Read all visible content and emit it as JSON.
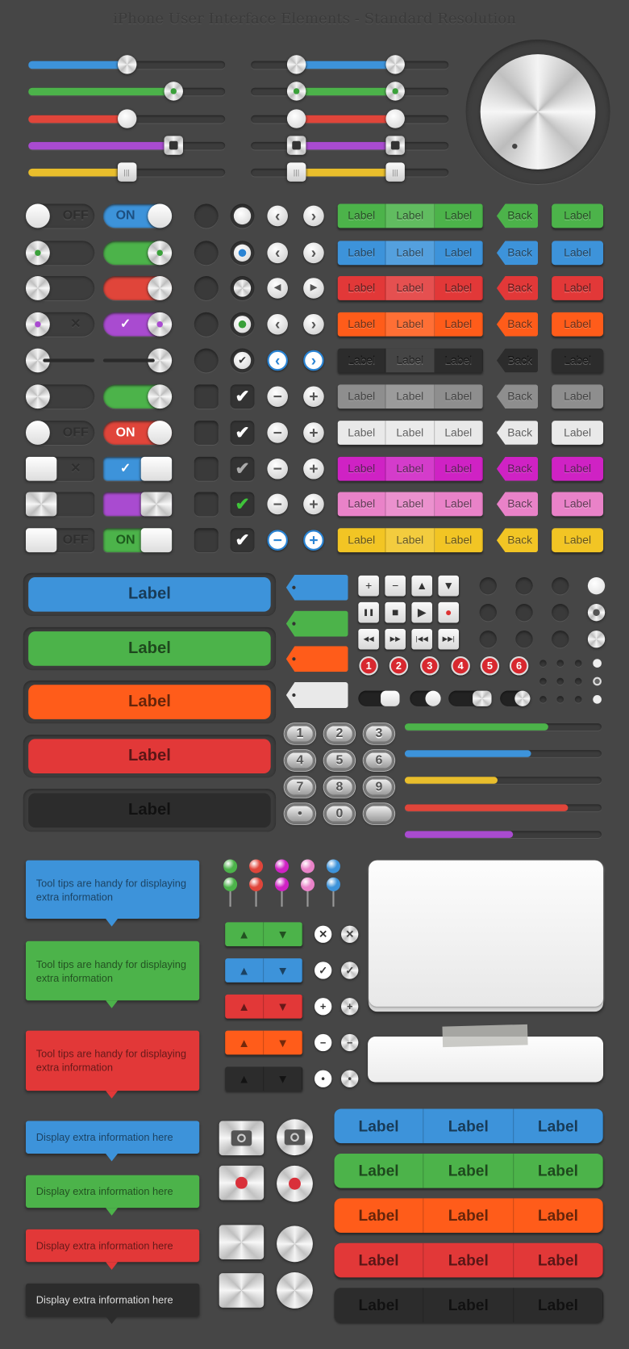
{
  "title": "iPhone User Interface Elements - Standard Resolution",
  "colors": {
    "blue": "#3d93da",
    "green": "#4cb34a",
    "red": "#e0453a",
    "orange": "#ff5c1a",
    "purple": "#a94bd0",
    "yellow": "#e9be2c",
    "black": "#2c2c2c",
    "gray": "#8e8e8e",
    "white": "#e9e9e9",
    "magenta": "#cf22c4",
    "pink": "#e982c8",
    "gold": "#f2c524",
    "darkred": "#e23838"
  },
  "sliders_single": [
    {
      "color": "blue",
      "value": 0.5,
      "thumb": "metal-round"
    },
    {
      "color": "green",
      "value": 0.74,
      "thumb": "dot-round"
    },
    {
      "color": "red",
      "value": 0.5,
      "thumb": "plain-round"
    },
    {
      "color": "purple",
      "value": 0.74,
      "thumb": "square-hole"
    },
    {
      "color": "yellow",
      "value": 0.5,
      "thumb": "grip-square"
    }
  ],
  "sliders_range": [
    {
      "color": "blue",
      "low": 0.23,
      "high": 0.73
    },
    {
      "color": "green",
      "low": 0.23,
      "high": 0.73
    },
    {
      "color": "red",
      "low": 0.23,
      "high": 0.73
    },
    {
      "color": "purple",
      "low": 0.23,
      "high": 0.73
    },
    {
      "color": "yellow",
      "low": 0.23,
      "high": 0.73
    }
  ],
  "knob": {
    "icon": "metal-dial"
  },
  "toggle_rows": [
    {
      "off_label": "OFF",
      "on_label": "ON",
      "on_color": "blue",
      "nav": [
        "chevron-left",
        "chevron-right"
      ],
      "color": "green",
      "check": "radio-empty"
    },
    {
      "off_label": "",
      "on_label": "",
      "on_color": "green",
      "nav": [
        "chevron-left",
        "chevron-right"
      ],
      "color": "blue",
      "check": "radio-blue"
    },
    {
      "off_label": "",
      "on_label": "",
      "on_color": "red",
      "nav": [
        "triangle-left",
        "triangle-right"
      ],
      "color": "darkred",
      "check": "radio-metal"
    },
    {
      "off_label": "✕",
      "on_label": "✓",
      "on_color": "purple",
      "nav": [
        "chevron-left",
        "chevron-right"
      ],
      "color": "orange",
      "check": "radio-green"
    },
    {
      "off_label": "",
      "on_label": "",
      "on_color": "none",
      "nav": [
        "chevron-left",
        "chevron-right"
      ],
      "color": "black",
      "check": "radio-check"
    },
    {
      "off_label": "",
      "on_label": "",
      "on_color": "green",
      "nav": [
        "minus",
        "plus"
      ],
      "color": "gray",
      "check": "check-white"
    },
    {
      "off_label": "OFF",
      "on_label": "ON",
      "on_color": "red",
      "nav": [
        "minus",
        "plus"
      ],
      "color": "white",
      "check": "check-white"
    },
    {
      "off_label": "✕",
      "on_label": "✓",
      "on_color": "blue",
      "nav": [
        "minus",
        "plus"
      ],
      "color": "magenta",
      "check": "check-gray"
    },
    {
      "off_label": "",
      "on_label": "",
      "on_color": "purple",
      "nav": [
        "minus",
        "plus"
      ],
      "color": "pink",
      "check": "check-green"
    },
    {
      "off_label": "OFF",
      "on_label": "ON",
      "on_color": "green",
      "nav": [
        "minus",
        "plus"
      ],
      "color": "gold",
      "check": "check-white"
    }
  ],
  "segment_labels": [
    "Label",
    "Label",
    "Label"
  ],
  "back_label": "Back",
  "single_label": "Label",
  "big_buttons": [
    {
      "label": "Label",
      "color": "blue"
    },
    {
      "label": "Label",
      "color": "green"
    },
    {
      "label": "Label",
      "color": "orange"
    },
    {
      "label": "Label",
      "color": "darkred"
    },
    {
      "label": "Label",
      "color": "black"
    }
  ],
  "tags": [
    "blue",
    "green",
    "orange",
    "white"
  ],
  "media_buttons": [
    [
      {
        "icon": "plus-icon",
        "glyph": "+"
      },
      {
        "icon": "minus-icon",
        "glyph": "−"
      },
      {
        "icon": "up-icon",
        "glyph": "▲"
      },
      {
        "icon": "down-icon",
        "glyph": "▼"
      }
    ],
    [
      {
        "icon": "pause-icon",
        "glyph": "❚❚"
      },
      {
        "icon": "stop-icon",
        "glyph": "■"
      },
      {
        "icon": "play-icon",
        "glyph": "▶"
      },
      {
        "icon": "record-icon",
        "glyph": "●"
      }
    ],
    [
      {
        "icon": "rewind-icon",
        "glyph": "◀◀"
      },
      {
        "icon": "fast-forward-icon",
        "glyph": "▶▶"
      },
      {
        "icon": "skip-back-icon",
        "glyph": "|◀◀"
      },
      {
        "icon": "skip-forward-icon",
        "glyph": "▶▶|"
      }
    ]
  ],
  "badges": [
    "1",
    "2",
    "3",
    "4",
    "5",
    "6"
  ],
  "numpad": [
    "1",
    "2",
    "3",
    "4",
    "5",
    "6",
    "7",
    "8",
    "9",
    "•",
    "0",
    ""
  ],
  "progress": [
    {
      "color": "green",
      "value": 0.73
    },
    {
      "color": "blue",
      "value": 0.64
    },
    {
      "color": "yellow",
      "value": 0.47
    },
    {
      "color": "red",
      "value": 0.83
    },
    {
      "color": "purple",
      "value": 0.55
    }
  ],
  "tooltips_large": [
    {
      "text": "Tool tips are handy for displaying extra information",
      "color": "blue"
    },
    {
      "text": "Tool tips are handy for displaying extra information",
      "color": "green"
    },
    {
      "text": "Tool tips are handy for displaying extra information",
      "color": "darkred"
    }
  ],
  "pins": [
    "green",
    "red",
    "magenta",
    "pink",
    "blue"
  ],
  "steppers": [
    "green",
    "blue",
    "darkred",
    "orange",
    "black"
  ],
  "round_icons": [
    {
      "icon": "close",
      "glyph": "✕"
    },
    {
      "icon": "check",
      "glyph": "✓"
    },
    {
      "icon": "plus",
      "glyph": "+"
    },
    {
      "icon": "minus",
      "glyph": "−"
    },
    {
      "icon": "dot",
      "glyph": "•"
    }
  ],
  "tooltips_small": [
    {
      "text": "Display extra information here",
      "color": "blue"
    },
    {
      "text": "Display extra information here",
      "color": "green"
    },
    {
      "text": "Display extra information here",
      "color": "darkred"
    },
    {
      "text": "Display extra information here",
      "color": "black"
    }
  ],
  "metal_buttons": [
    "camera",
    "record",
    "blank",
    "blank"
  ],
  "segmented_large": [
    {
      "color": "blue",
      "labels": [
        "Label",
        "Label",
        "Label"
      ]
    },
    {
      "color": "green",
      "labels": [
        "Label",
        "Label",
        "Label"
      ]
    },
    {
      "color": "orange",
      "labels": [
        "Label",
        "Label",
        "Label"
      ]
    },
    {
      "color": "darkred",
      "labels": [
        "Label",
        "Label",
        "Label"
      ]
    },
    {
      "color": "black",
      "labels": [
        "Label",
        "Label",
        "Label"
      ]
    }
  ]
}
